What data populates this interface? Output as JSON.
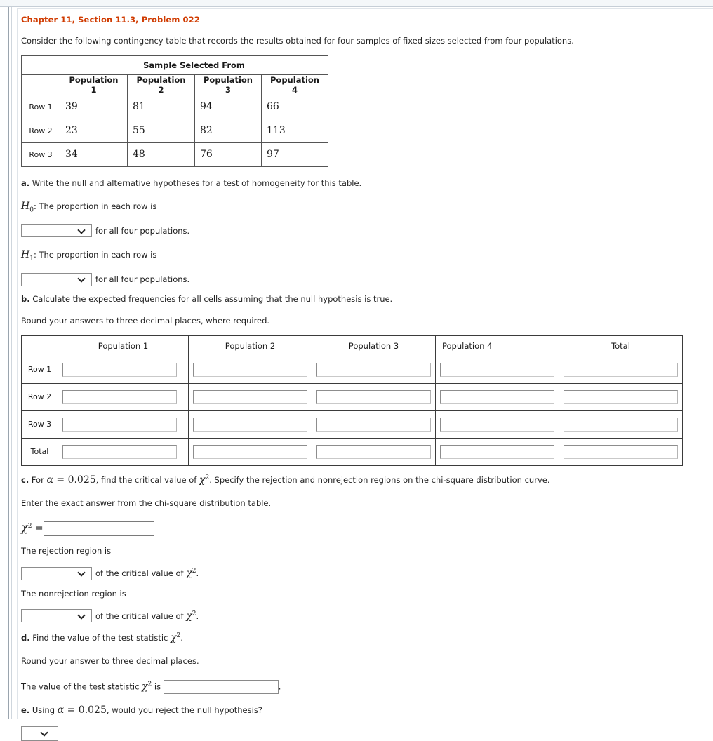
{
  "window": {
    "accent_color": "#d03c02",
    "panel_bg": "#ffffff",
    "chrome_bg": "#f4f7f9"
  },
  "problem": {
    "title": "Chapter 11, Section 11.3, Problem 022",
    "intro": "Consider the following contingency table that records the results obtained for four samples of fixed sizes selected from four populations."
  },
  "contingency_table": {
    "span_header": "Sample Selected From",
    "column_headers": [
      "Population 1",
      "Population 2",
      "Population 3",
      "Population 4"
    ],
    "rows": [
      {
        "label": "Row 1",
        "values": [
          "39",
          "81",
          "94",
          "66"
        ]
      },
      {
        "label": "Row 2",
        "values": [
          "23",
          "55",
          "82",
          "113"
        ]
      },
      {
        "label": "Row 3",
        "values": [
          "34",
          "48",
          "76",
          "97"
        ]
      }
    ]
  },
  "part_a": {
    "prompt_bold": "a.",
    "prompt": " Write the null and alternative hypotheses for a test of homogeneity for this table.",
    "h0_symbol": "H",
    "h0_sub": "0",
    "h0_text": ": The proportion in each row is",
    "h1_symbol": "H",
    "h1_sub": "1",
    "h1_text": ": The proportion in each row is",
    "select_h0_value": "",
    "select_h1_value": "",
    "trailing_text": "for all four populations."
  },
  "part_b": {
    "prompt_bold": "b.",
    "prompt": " Calculate the expected frequencies for all cells assuming that the null hypothesis is true.",
    "rounding_note": "Round your answers to three decimal places, where required.",
    "table": {
      "column_headers": [
        "Population 1",
        "Population 2",
        "Population 3",
        "Population 4",
        "Total"
      ],
      "row_labels": [
        "Row 1",
        "Row 2",
        "Row 3",
        "Total"
      ],
      "cell_values": [
        [
          "",
          "",
          "",
          "",
          ""
        ],
        [
          "",
          "",
          "",
          "",
          ""
        ],
        [
          "",
          "",
          "",
          "",
          ""
        ],
        [
          "",
          "",
          "",
          "",
          ""
        ]
      ]
    }
  },
  "part_c": {
    "prompt_bold": "c.",
    "prompt_1": " For ",
    "alpha": "α",
    "equals": " = ",
    "alpha_value": "0.025",
    "prompt_2": ", find the critical value of ",
    "chi": "χ",
    "chi_exp": "2",
    "prompt_3": ". Specify the rejection and nonrejection regions on the chi-square distribution curve.",
    "exact_note": "Enter the exact answer from the chi-square distribution table.",
    "chi_input_value": "",
    "rejection_label": "The rejection region is",
    "rejection_select_value": "",
    "rejection_after": "of the critical value of ",
    "nonrejection_label": "The nonrejection region is",
    "nonrejection_select_value": "",
    "nonrejection_after": "of the critical value of "
  },
  "part_d": {
    "prompt_bold": "d.",
    "prompt_1": " Find the value of the test statistic ",
    "chi": "χ",
    "chi_exp": "2",
    "prompt_2": ".",
    "rounding_note": "Round your answer to three decimal places.",
    "statement_1": "The value of the test statistic ",
    "statement_2": " is",
    "statistic_input_value": "",
    "period": "."
  },
  "part_e": {
    "prompt_bold": "e.",
    "prompt_1": " Using ",
    "alpha": "α",
    "equals": " = ",
    "alpha_value": "0.025",
    "prompt_2": ", would you reject the null hypothesis?",
    "select_value": ""
  }
}
